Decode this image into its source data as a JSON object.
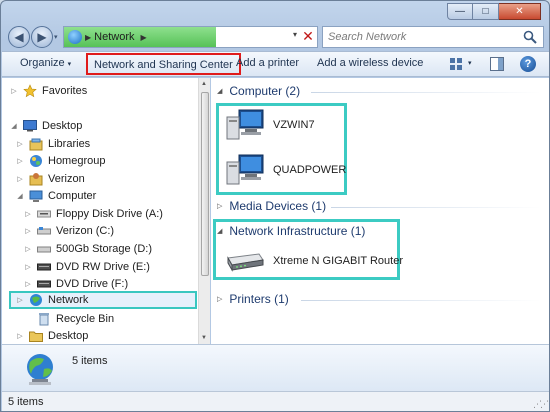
{
  "window": {
    "minimize_glyph": "—",
    "maximize_glyph": "□",
    "close_glyph": "✕"
  },
  "nav": {
    "back_glyph": "◀",
    "forward_glyph": "▶",
    "history_glyph": "▾",
    "address_segment": "Network",
    "address_arrow": "▶",
    "address_dropdown_glyph": "▾",
    "stop_glyph": "✕",
    "address_progress": 0.6,
    "accent": "#57c257"
  },
  "search": {
    "placeholder": "Search Network"
  },
  "toolbar": {
    "organize_label": "Organize",
    "organize_caret": "▾",
    "network_sharing_label": "Network and Sharing Center",
    "add_printer_label": "Add a printer",
    "add_wireless_label": "Add a wireless device",
    "views_caret": "▾",
    "help_glyph": "?",
    "highlight_color": "#e01b1b"
  },
  "sidebar": {
    "highlight_color": "#39c7c0",
    "items": [
      {
        "label": "Favorites",
        "icon": "star-icon",
        "expander": "▷"
      },
      {
        "label": "Desktop",
        "icon": "desktop-icon",
        "expander": "◢"
      },
      {
        "label": "Libraries",
        "icon": "libraries-icon",
        "expander": "▷"
      },
      {
        "label": "Homegroup",
        "icon": "homegroup-icon",
        "expander": "▷"
      },
      {
        "label": "Verizon",
        "icon": "user-folder-icon",
        "expander": "▷"
      },
      {
        "label": "Computer",
        "icon": "computer-icon",
        "expander": "◢"
      },
      {
        "label": "Floppy Disk Drive (A:)",
        "icon": "floppy-icon",
        "expander": "▷"
      },
      {
        "label": "Verizon (C:)",
        "icon": "drive-icon",
        "expander": "▷"
      },
      {
        "label": "500Gb Storage (D:)",
        "icon": "drive-icon",
        "expander": "▷"
      },
      {
        "label": "DVD RW Drive (E:)",
        "icon": "dvd-icon",
        "expander": "▷"
      },
      {
        "label": "DVD Drive (F:)",
        "icon": "dvd-icon",
        "expander": "▷"
      },
      {
        "label": "Network",
        "icon": "network-icon",
        "expander": "▷"
      },
      {
        "label": "Recycle Bin",
        "icon": "recycle-bin-icon",
        "expander": ""
      },
      {
        "label": "Desktop",
        "icon": "folder-icon",
        "expander": "▷"
      }
    ],
    "scroll_up": "▲",
    "scroll_down": "▼"
  },
  "content": {
    "highlight_color": "#3ccbc3",
    "groups": [
      {
        "label": "Computer (2)",
        "expander": "◢"
      },
      {
        "label": "Media Devices (1)",
        "expander": "▷"
      },
      {
        "label": "Network Infrastructure (1)",
        "expander": "◢"
      },
      {
        "label": "Printers (1)",
        "expander": "▷"
      }
    ],
    "items": [
      {
        "label": "VZWIN7",
        "icon": "computer-icon"
      },
      {
        "label": "QUADPOWER",
        "icon": "computer-icon"
      },
      {
        "label": "Xtreme N GIGABIT Router",
        "icon": "router-icon"
      }
    ]
  },
  "details": {
    "count_text": "5 items",
    "icon": "network-globe-icon"
  },
  "status": {
    "text": "5 items",
    "grip": "⋰⋰"
  }
}
